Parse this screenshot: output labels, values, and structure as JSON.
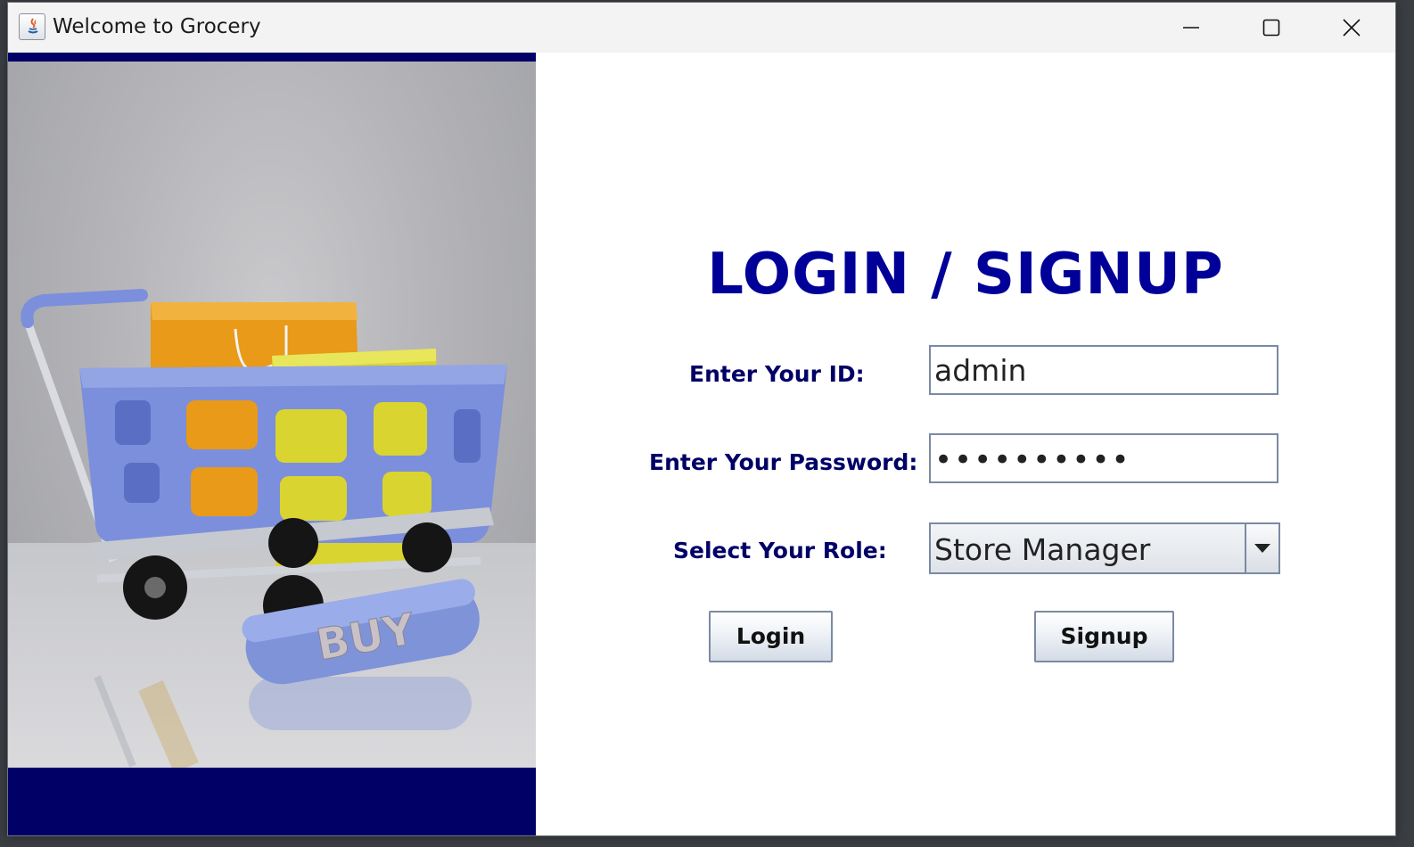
{
  "window": {
    "title": "Welcome to Grocery",
    "controls": {
      "minimize": "minimize",
      "maximize": "maximize",
      "close": "close"
    }
  },
  "image": {
    "subject": "shopping cart with shopping bags",
    "badge_text": "BUY"
  },
  "form": {
    "heading": "LOGIN / SIGNUP",
    "id_label": "Enter Your ID:",
    "id_value": "admin",
    "password_label": "Enter Your Password:",
    "password_value": "••••••••••",
    "role_label": "Select Your Role:",
    "role_selected": "Store Manager",
    "login_button": "Login",
    "signup_button": "Signup"
  },
  "colors": {
    "heading": "#000099",
    "labels": "#000066",
    "side_bars": "#000066"
  }
}
